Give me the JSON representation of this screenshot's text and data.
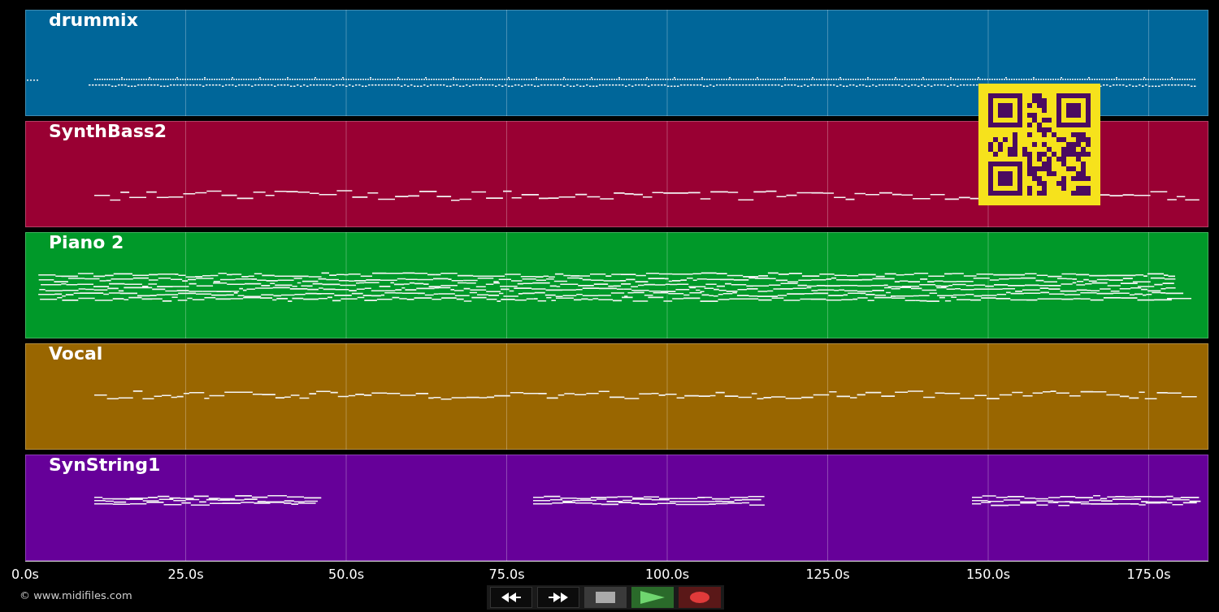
{
  "tracks": [
    {
      "name": "drummix",
      "color": "#006699",
      "kind": "drums"
    },
    {
      "name": "SynthBass2",
      "color": "#990033",
      "kind": "bass"
    },
    {
      "name": "Piano 2",
      "color": "#009929",
      "kind": "chords"
    },
    {
      "name": "Vocal",
      "color": "#996600",
      "kind": "melody"
    },
    {
      "name": "SynString1",
      "color": "#660099",
      "kind": "pads"
    }
  ],
  "time_axis": [
    "0.0s",
    "25.0s",
    "50.0s",
    "75.0s",
    "100.0s",
    "125.0s",
    "150.0s",
    "175.0s"
  ],
  "copyright": "© www.midifiles.com",
  "transport": [
    {
      "kind": "rewind"
    },
    {
      "kind": "forward"
    },
    {
      "kind": "stop"
    },
    {
      "kind": "play"
    },
    {
      "kind": "record"
    }
  ]
}
